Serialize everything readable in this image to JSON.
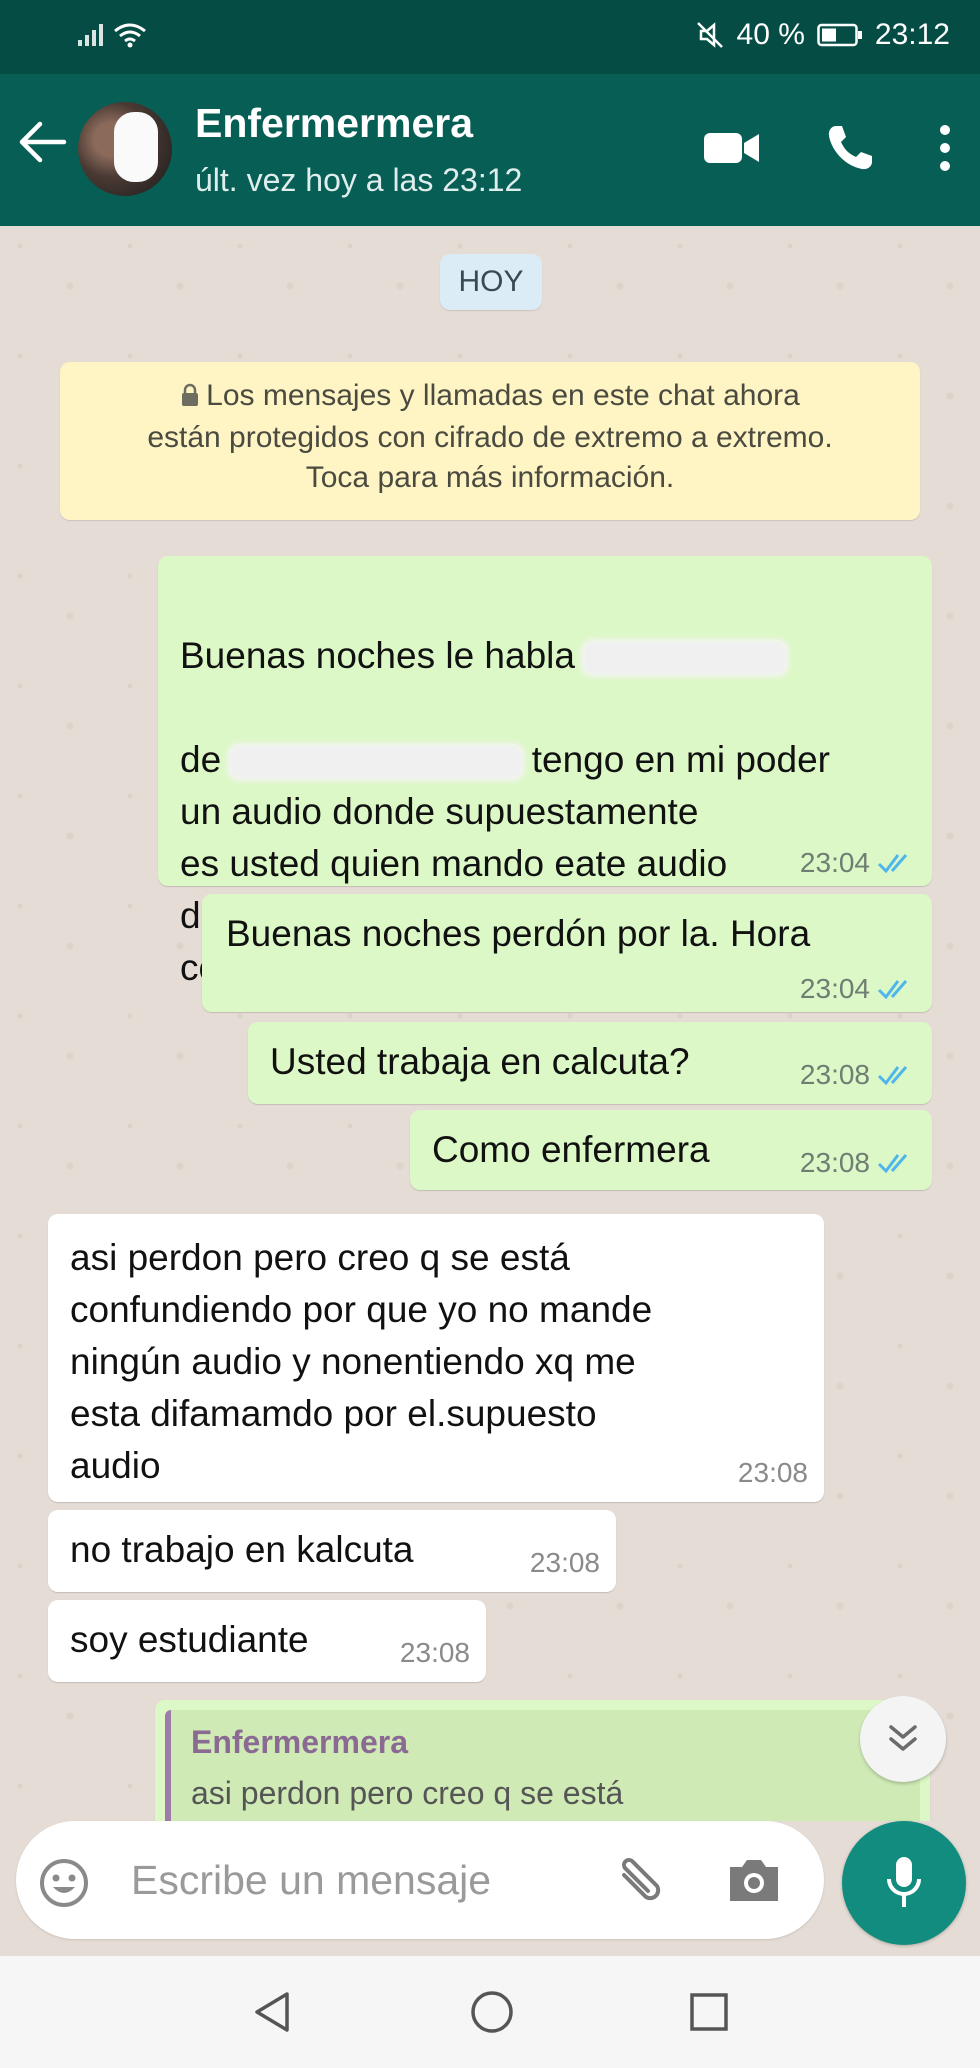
{
  "status_bar": {
    "battery_percent": "40 %",
    "time": "23:12"
  },
  "header": {
    "contact_name": "Enfermermera",
    "last_seen": "últ. vez hoy a las 23:12"
  },
  "chat": {
    "date_chip": "HOY",
    "encryption_notice": "Los mensajes y llamadas en este chat ahora\nestán protegidos con cifrado de extremo a extremo.\nToca para más información.",
    "messages": [
      {
        "direction": "out",
        "text": "tengo en mi poder\nun audio donde supuestamente\nes usted quien mando eate audio\ndel caso en Potosí.... Me . Gustaría\nconfirmar ese dato por favor",
        "time": "23:04",
        "prefix_1": "Buenas noches le habla",
        "prefix_2": "de"
      },
      {
        "direction": "out",
        "text": "Buenas noches perdón por la. Hora",
        "time": "23:04"
      },
      {
        "direction": "out",
        "text": "Usted trabaja en calcuta?",
        "time": "23:08"
      },
      {
        "direction": "out",
        "text": "Como enfermera",
        "time": "23:08"
      },
      {
        "direction": "in",
        "text": "asi perdon  pero creo q se está\nconfundiendo  por que   yo no mande\nningún audio  y nonentiendo xq me\nesta difamamdo por  el.supuesto\naudio",
        "time": "23:08"
      },
      {
        "direction": "in",
        "text": "no trabajo  en kalcuta",
        "time": "23:08"
      },
      {
        "direction": "in",
        "text": "soy estudiante",
        "time": "23:08"
      }
    ],
    "quoted_reply": {
      "name": "Enfermermera",
      "text": "asi perdon  pero creo q se está"
    }
  },
  "input": {
    "placeholder": "Escribe un mensaje"
  },
  "colors": {
    "header": "#075e54",
    "status_bar": "#054d44",
    "outgoing_bubble": "#dcf8c6",
    "incoming_bubble": "#ffffff",
    "read_ticks": "#4fb6ec",
    "mic_button": "#128c7e"
  },
  "icons": {
    "header": [
      "back-arrow-icon",
      "video-call-icon",
      "voice-call-icon",
      "more-options-icon"
    ],
    "input": [
      "emoji-icon",
      "attach-icon",
      "camera-icon",
      "mic-icon"
    ],
    "nav": [
      "nav-back-icon",
      "nav-home-icon",
      "nav-recents-icon"
    ]
  }
}
